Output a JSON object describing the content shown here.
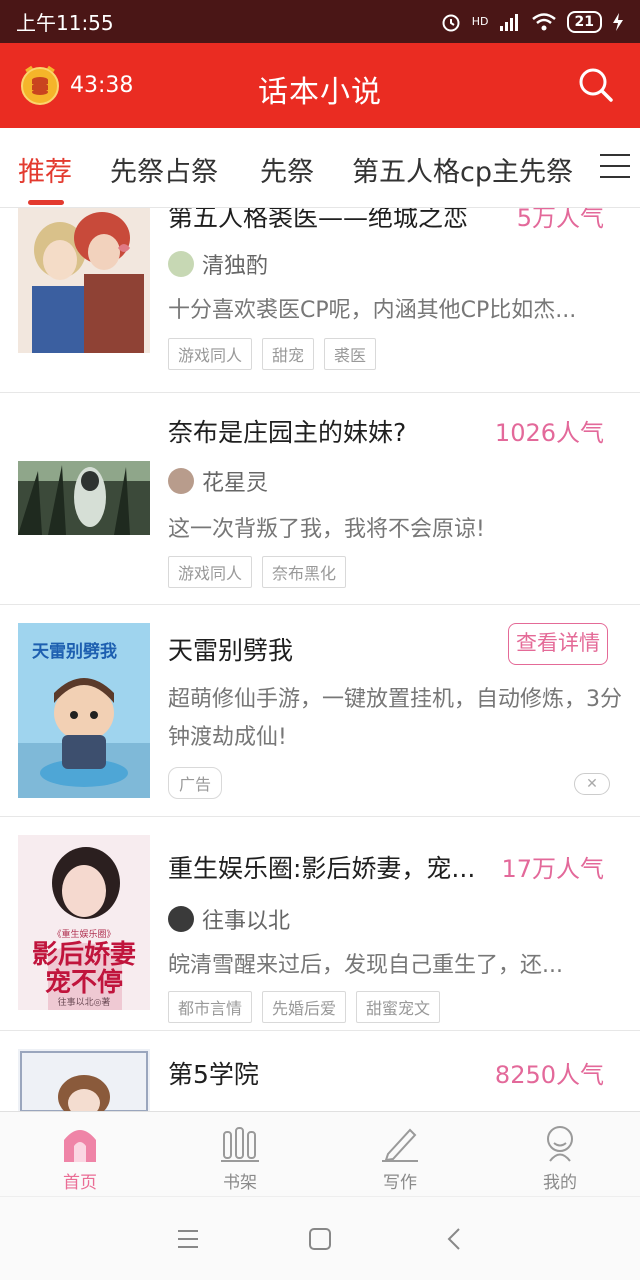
{
  "status_bar": {
    "time": "上午11:55",
    "network": "HD",
    "battery": "21"
  },
  "header": {
    "timer": "43:38",
    "title": "话本小说"
  },
  "tabs": [
    {
      "label": "推荐",
      "active": true
    },
    {
      "label": "先祭占祭",
      "active": false
    },
    {
      "label": "先祭",
      "active": false
    },
    {
      "label": "第五人格cp主先祭",
      "active": false
    }
  ],
  "feed": [
    {
      "title": "第五人格裘医——绝城之恋",
      "popularity": "5万人气",
      "author": "清独酌",
      "description": "十分喜欢裘医CP呢，内涵其他CP比如杰...",
      "tags": [
        "游戏同人",
        "甜宠",
        "裘医"
      ]
    },
    {
      "title": "奈布是庄园主的妹妹?",
      "popularity": "1026人气",
      "author": "花星灵",
      "description": "这一次背叛了我，我将不会原谅!",
      "tags": [
        "游戏同人",
        "奈布黑化"
      ]
    },
    {
      "ad": true,
      "title": "天雷别劈我",
      "detail_button": "查看详情",
      "description": "超萌修仙手游，一键放置挂机，自动修炼，3分钟渡劫成仙!",
      "ad_label": "广告",
      "cover_text": "天雷别劈我"
    },
    {
      "title": "重生娱乐圈:影后娇妻，宠...",
      "popularity": "17万人气",
      "author": "往事以北",
      "description": "皖清雪醒来过后，发现自己重生了，还...",
      "tags": [
        "都市言情",
        "先婚后爱",
        "甜蜜宠文"
      ],
      "cover_text": "影后娇妻宠不停",
      "cover_subtitle": "《重生娱乐圈》",
      "cover_author": "往事以北◎著"
    },
    {
      "title": "第5学院",
      "popularity": "8250人气"
    }
  ],
  "bottom_nav": [
    {
      "label": "首页",
      "active": true,
      "icon": "home-icon"
    },
    {
      "label": "书架",
      "active": false,
      "icon": "bookshelf-icon"
    },
    {
      "label": "写作",
      "active": false,
      "icon": "pen-icon"
    },
    {
      "label": "我的",
      "active": false,
      "icon": "user-icon"
    }
  ],
  "colors": {
    "primary": "#ea2c22",
    "accent": "#e3699a",
    "status_bar": "#4a1616"
  }
}
